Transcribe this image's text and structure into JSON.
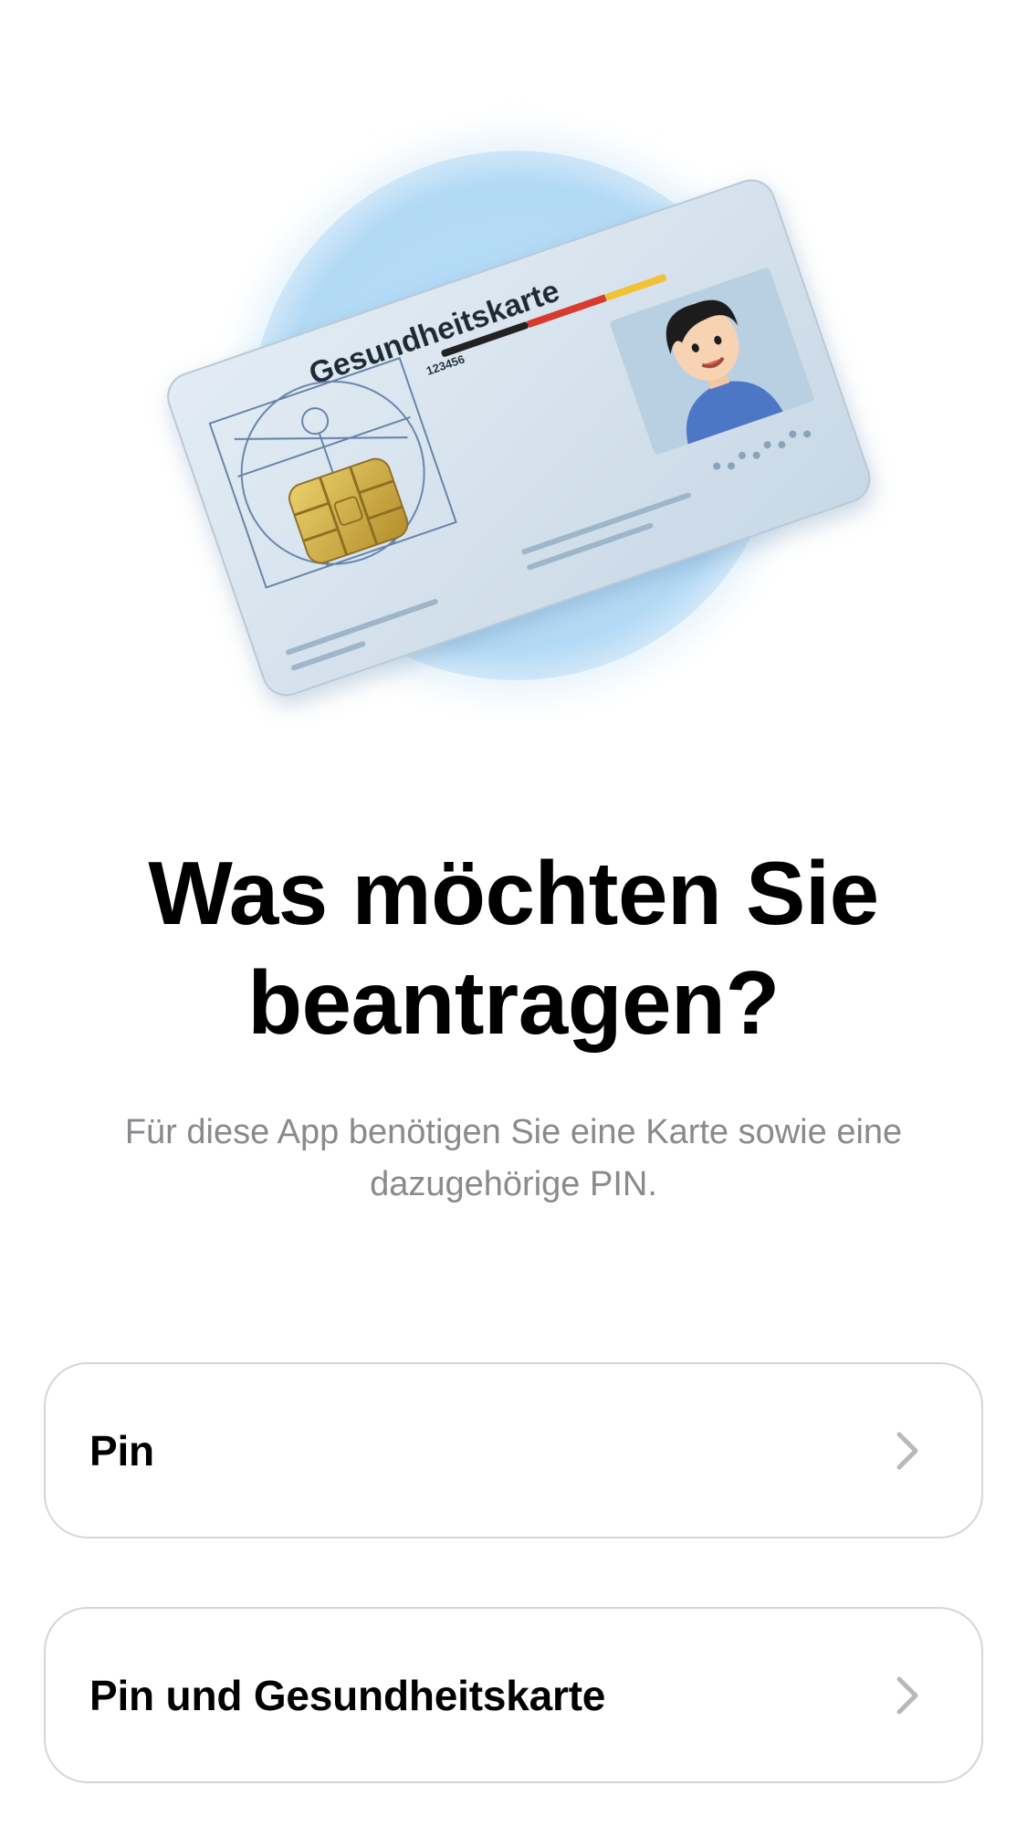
{
  "illustration": {
    "card_title": "Gesundheitskarte",
    "card_number": "123456",
    "circle_color": "#b5dcf6",
    "card_color": "#d5e2ee",
    "chip_color": "#d4b04a",
    "stripe_colors": [
      "#222222",
      "#d83a2e",
      "#f2c230"
    ]
  },
  "headline": {
    "line1": "Was möchten Sie",
    "line2": "beantragen?"
  },
  "subtitle": {
    "line1": "Für diese App benötigen Sie eine Karte sowie eine",
    "line2": "dazugehörige PIN."
  },
  "options": [
    {
      "label": "Pin",
      "icon": "chevron-right-icon"
    },
    {
      "label": "Pin und Gesundheitskarte",
      "icon": "chevron-right-icon"
    }
  ],
  "colors": {
    "text_primary": "#000000",
    "text_secondary": "#8a8a8e",
    "border": "#d6d6d9",
    "chevron": "#b9b9bd"
  }
}
